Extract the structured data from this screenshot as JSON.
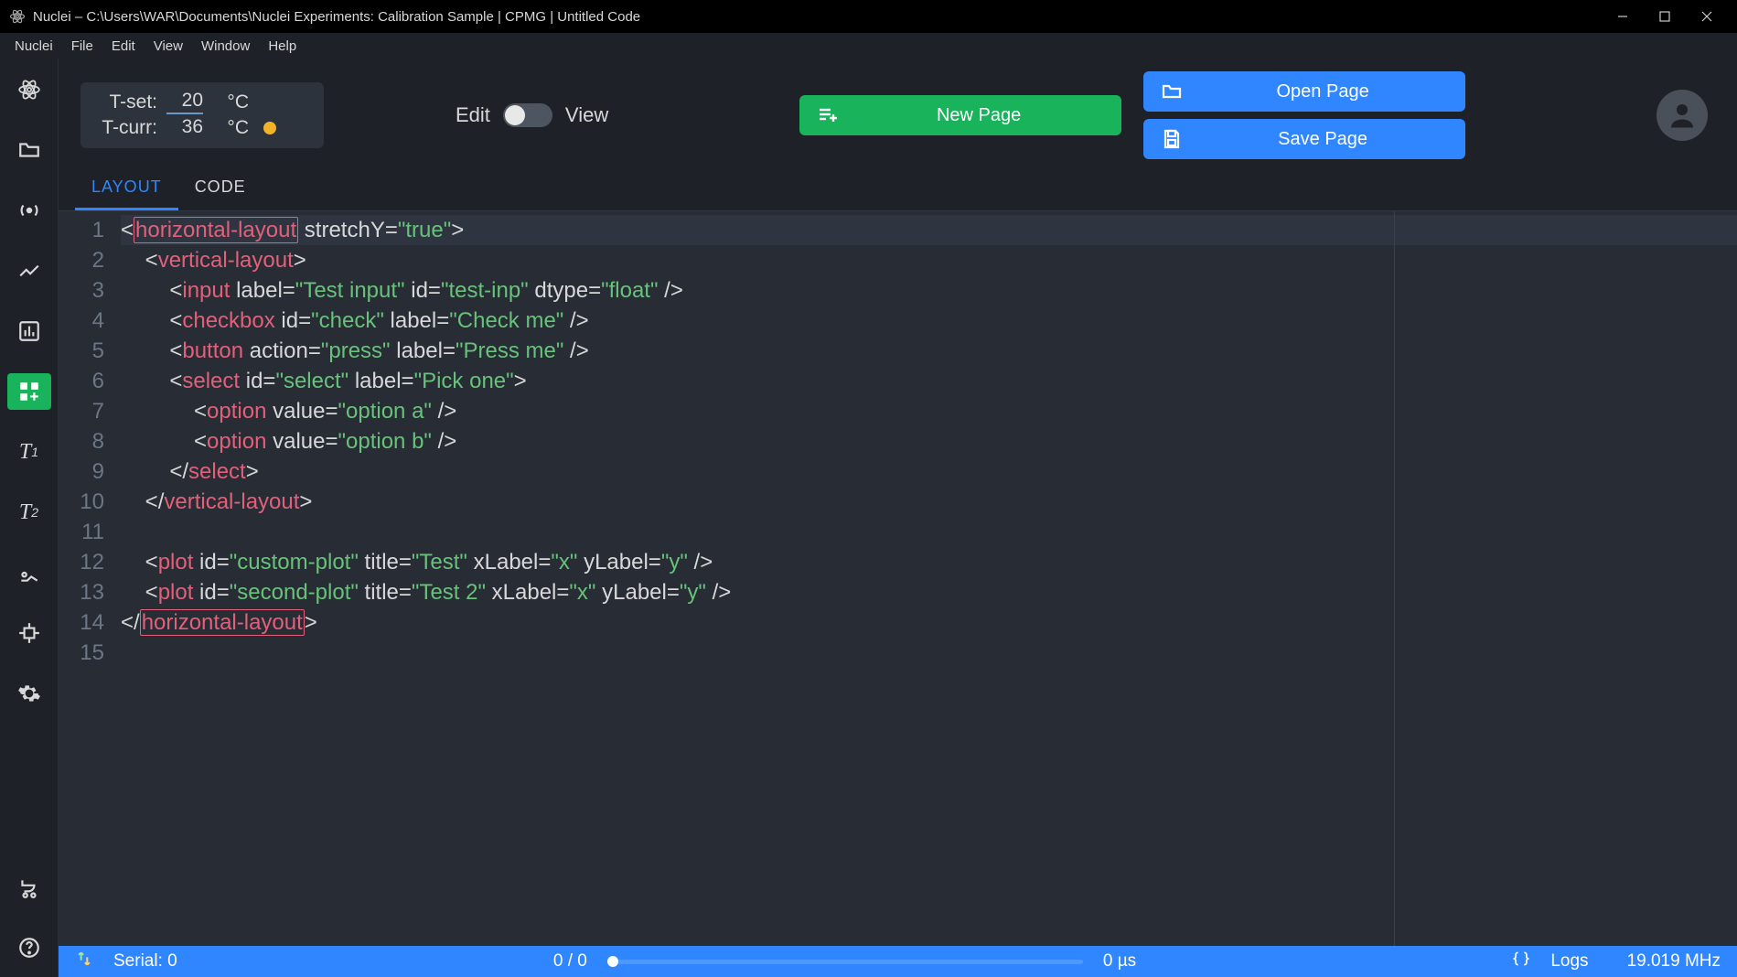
{
  "titlebar": {
    "app": "Nuclei",
    "path": "C:\\Users\\WAR\\Documents\\Nuclei Experiments: Calibration Sample | CPMG | Untitled Code"
  },
  "menubar": [
    "Nuclei",
    "File",
    "Edit",
    "View",
    "Window",
    "Help"
  ],
  "temp": {
    "t_set_label": "T-set:",
    "t_set_value": "20",
    "t_set_unit": "°C",
    "t_curr_label": "T-curr:",
    "t_curr_value": "36",
    "t_curr_unit": "°C"
  },
  "toggle": {
    "left": "Edit",
    "right": "View"
  },
  "buttons": {
    "new_page": "New Page",
    "open_page": "Open Page",
    "save_page": "Save Page"
  },
  "code_tabs": {
    "layout": "LAYOUT",
    "code": "CODE"
  },
  "code_lines": [
    {
      "n": "1",
      "tokens": [
        {
          "t": "<",
          "c": "brack"
        },
        {
          "t": "horizontal-layout",
          "c": "tag",
          "hl": true
        },
        {
          "t": " stretchY",
          "c": "attr"
        },
        {
          "t": "=",
          "c": "brack"
        },
        {
          "t": "\"true\"",
          "c": "str"
        },
        {
          "t": ">",
          "c": "brack"
        }
      ],
      "cur": true
    },
    {
      "n": "2",
      "indent": 1,
      "tokens": [
        {
          "t": "<",
          "c": "brack"
        },
        {
          "t": "vertical-layout",
          "c": "tag"
        },
        {
          "t": ">",
          "c": "brack"
        }
      ]
    },
    {
      "n": "3",
      "indent": 2,
      "tokens": [
        {
          "t": "<",
          "c": "brack"
        },
        {
          "t": "input",
          "c": "tag"
        },
        {
          "t": " label",
          "c": "attr"
        },
        {
          "t": "=",
          "c": "brack"
        },
        {
          "t": "\"Test input\"",
          "c": "str"
        },
        {
          "t": " id",
          "c": "attr"
        },
        {
          "t": "=",
          "c": "brack"
        },
        {
          "t": "\"test-inp\"",
          "c": "str"
        },
        {
          "t": " dtype",
          "c": "attr"
        },
        {
          "t": "=",
          "c": "brack"
        },
        {
          "t": "\"float\"",
          "c": "str"
        },
        {
          "t": " />",
          "c": "brack"
        }
      ]
    },
    {
      "n": "4",
      "indent": 2,
      "tokens": [
        {
          "t": "<",
          "c": "brack"
        },
        {
          "t": "checkbox",
          "c": "tag"
        },
        {
          "t": " id",
          "c": "attr"
        },
        {
          "t": "=",
          "c": "brack"
        },
        {
          "t": "\"check\"",
          "c": "str"
        },
        {
          "t": " label",
          "c": "attr"
        },
        {
          "t": "=",
          "c": "brack"
        },
        {
          "t": "\"Check me\"",
          "c": "str"
        },
        {
          "t": " />",
          "c": "brack"
        }
      ]
    },
    {
      "n": "5",
      "indent": 2,
      "tokens": [
        {
          "t": "<",
          "c": "brack"
        },
        {
          "t": "button",
          "c": "tag"
        },
        {
          "t": " action",
          "c": "attr"
        },
        {
          "t": "=",
          "c": "brack"
        },
        {
          "t": "\"press\"",
          "c": "str"
        },
        {
          "t": " label",
          "c": "attr"
        },
        {
          "t": "=",
          "c": "brack"
        },
        {
          "t": "\"Press me\"",
          "c": "str"
        },
        {
          "t": " />",
          "c": "brack"
        }
      ]
    },
    {
      "n": "6",
      "indent": 2,
      "tokens": [
        {
          "t": "<",
          "c": "brack"
        },
        {
          "t": "select",
          "c": "tag"
        },
        {
          "t": " id",
          "c": "attr"
        },
        {
          "t": "=",
          "c": "brack"
        },
        {
          "t": "\"select\"",
          "c": "str"
        },
        {
          "t": " label",
          "c": "attr"
        },
        {
          "t": "=",
          "c": "brack"
        },
        {
          "t": "\"Pick one\"",
          "c": "str"
        },
        {
          "t": ">",
          "c": "brack"
        }
      ]
    },
    {
      "n": "7",
      "indent": 3,
      "tokens": [
        {
          "t": "<",
          "c": "brack"
        },
        {
          "t": "option",
          "c": "tag"
        },
        {
          "t": " value",
          "c": "attr"
        },
        {
          "t": "=",
          "c": "brack"
        },
        {
          "t": "\"option a\"",
          "c": "str"
        },
        {
          "t": " />",
          "c": "brack"
        }
      ]
    },
    {
      "n": "8",
      "indent": 3,
      "tokens": [
        {
          "t": "<",
          "c": "brack"
        },
        {
          "t": "option",
          "c": "tag"
        },
        {
          "t": " value",
          "c": "attr"
        },
        {
          "t": "=",
          "c": "brack"
        },
        {
          "t": "\"option b\"",
          "c": "str"
        },
        {
          "t": " />",
          "c": "brack"
        }
      ]
    },
    {
      "n": "9",
      "indent": 2,
      "tokens": [
        {
          "t": "</",
          "c": "brack"
        },
        {
          "t": "select",
          "c": "tag"
        },
        {
          "t": ">",
          "c": "brack"
        }
      ]
    },
    {
      "n": "10",
      "indent": 1,
      "tokens": [
        {
          "t": "</",
          "c": "brack"
        },
        {
          "t": "vertical-layout",
          "c": "tag"
        },
        {
          "t": ">",
          "c": "brack"
        }
      ]
    },
    {
      "n": "11",
      "tokens": []
    },
    {
      "n": "12",
      "indent": 1,
      "tokens": [
        {
          "t": "<",
          "c": "brack"
        },
        {
          "t": "plot",
          "c": "tag"
        },
        {
          "t": " id",
          "c": "attr"
        },
        {
          "t": "=",
          "c": "brack"
        },
        {
          "t": "\"custom-plot\"",
          "c": "str"
        },
        {
          "t": " title",
          "c": "attr"
        },
        {
          "t": "=",
          "c": "brack"
        },
        {
          "t": "\"Test\"",
          "c": "str"
        },
        {
          "t": " xLabel",
          "c": "attr"
        },
        {
          "t": "=",
          "c": "brack"
        },
        {
          "t": "\"x\"",
          "c": "str"
        },
        {
          "t": " yLabel",
          "c": "attr"
        },
        {
          "t": "=",
          "c": "brack"
        },
        {
          "t": "\"y\"",
          "c": "str"
        },
        {
          "t": " />",
          "c": "brack"
        }
      ]
    },
    {
      "n": "13",
      "indent": 1,
      "tokens": [
        {
          "t": "<",
          "c": "brack"
        },
        {
          "t": "plot",
          "c": "tag"
        },
        {
          "t": " id",
          "c": "attr"
        },
        {
          "t": "=",
          "c": "brack"
        },
        {
          "t": "\"second-plot\"",
          "c": "str"
        },
        {
          "t": " title",
          "c": "attr"
        },
        {
          "t": "=",
          "c": "brack"
        },
        {
          "t": "\"Test 2\"",
          "c": "str"
        },
        {
          "t": " xLabel",
          "c": "attr"
        },
        {
          "t": "=",
          "c": "brack"
        },
        {
          "t": "\"x\"",
          "c": "str"
        },
        {
          "t": " yLabel",
          "c": "attr"
        },
        {
          "t": "=",
          "c": "brack"
        },
        {
          "t": "\"y\"",
          "c": "str"
        },
        {
          "t": " />",
          "c": "brack"
        }
      ]
    },
    {
      "n": "14",
      "tokens": [
        {
          "t": "</",
          "c": "brack"
        },
        {
          "t": "horizontal-layout",
          "c": "tag",
          "hl": true
        },
        {
          "t": ">",
          "c": "brack"
        }
      ]
    },
    {
      "n": "15",
      "tokens": []
    }
  ],
  "status": {
    "serial": "Serial: 0",
    "progress_frac": "0 / 0",
    "time": "0 µs",
    "logs": "Logs",
    "freq": "19.019 MHz"
  }
}
